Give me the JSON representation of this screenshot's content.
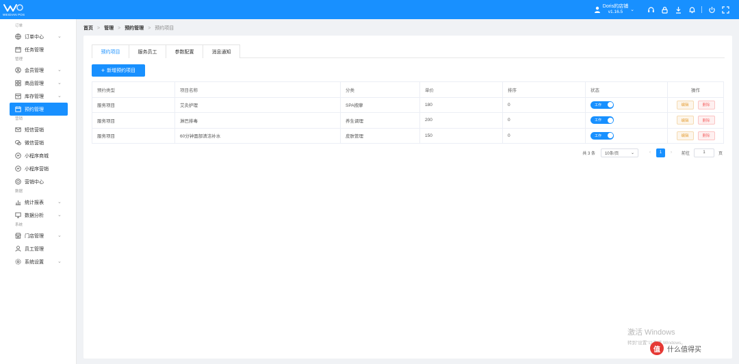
{
  "app": {
    "logo_text": "WEIDIAN POS"
  },
  "header": {
    "user_name": "Doris的店铺",
    "version": "v1.16.5"
  },
  "sidebar": {
    "groups": {
      "order": "订单",
      "manage": "管理",
      "marketing": "营销",
      "data": "数据",
      "system": "系统"
    },
    "items": {
      "order_center": "订单中心",
      "task_manage": "任务管理",
      "member_manage": "会员管理",
      "product_manage": "商品管理",
      "stock_manage": "库存管理",
      "booking_manage": "预约管理",
      "sms_marketing": "短信营销",
      "wechat_marketing": "微信营销",
      "mini_shop": "小程序商城",
      "mini_marketing": "小程序营销",
      "marketing_center": "营销中心",
      "stats_report": "统计报表",
      "data_analysis": "数据分析",
      "store_manage": "门店管理",
      "staff_manage": "员工管理",
      "system_settings": "系统设置"
    }
  },
  "breadcrumb": [
    "首页",
    "管理",
    "预约管理",
    "预约项目"
  ],
  "tabs": [
    "预约项目",
    "服务员工",
    "参数配置",
    "消息通知"
  ],
  "add_button": "新增预约项目",
  "table": {
    "headers": [
      "预约类型",
      "项目名称",
      "分类",
      "单价",
      "排序",
      "状态",
      "操作"
    ],
    "rows": [
      {
        "type": "服务项目",
        "name": "艾灸护理",
        "category": "SPA按摩",
        "price": "180",
        "sort": "0",
        "status": "工作"
      },
      {
        "type": "服务项目",
        "name": "淋巴排毒",
        "category": "养生调理",
        "price": "200",
        "sort": "0",
        "status": "工作"
      },
      {
        "type": "服务项目",
        "name": "60分钟面部清洁补水",
        "category": "皮肤管理",
        "price": "150",
        "sort": "0",
        "status": "工作"
      }
    ],
    "edit_label": "编辑",
    "delete_label": "删除"
  },
  "pagination": {
    "total": "共 3 条",
    "page_size": "10条/页",
    "current_page": "1",
    "goto_label": "前往",
    "goto_value": "1",
    "page_unit": "页"
  },
  "watermark": {
    "line1": "激活 Windows",
    "line2": "转到\"设置\"以激活 Windows。"
  },
  "corner_badge": {
    "icon_text": "值",
    "label": "什么值得买"
  },
  "colors": {
    "primary": "#1890ff",
    "edit": "#e6a23c",
    "delete": "#f56c6c"
  }
}
